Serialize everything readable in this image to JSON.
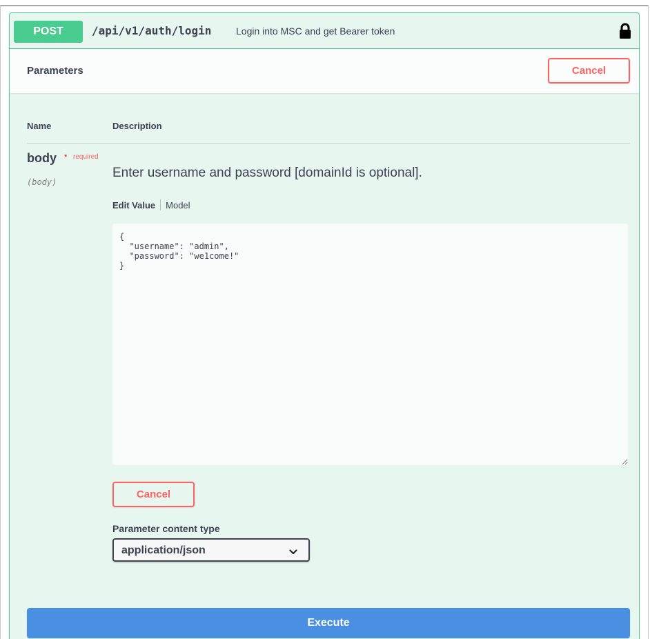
{
  "operation": {
    "method": "POST",
    "path": "/api/v1/auth/login",
    "summary": "Login into MSC and get Bearer token",
    "lock_icon": "lock-icon",
    "method_color": "#49cc90"
  },
  "parameters": {
    "title": "Parameters",
    "cancel_label": "Cancel",
    "columns": {
      "name": "Name",
      "description": "Description"
    },
    "body_param": {
      "name": "body",
      "required_star": "*",
      "required_label": "required",
      "location": "(body)",
      "description": "Enter username and password [domainId is optional].",
      "tabs": {
        "edit_value": "Edit Value",
        "model": "Model"
      },
      "value": "{\n  \"username\": \"admin\",\n  \"password\": \"we1come!\"\n}",
      "cancel_label": "Cancel"
    },
    "content_type": {
      "label": "Parameter content type",
      "selected": "application/json"
    }
  },
  "actions": {
    "execute_label": "Execute",
    "execute_color": "#4990e2",
    "cancel_color": "#ff6060"
  }
}
